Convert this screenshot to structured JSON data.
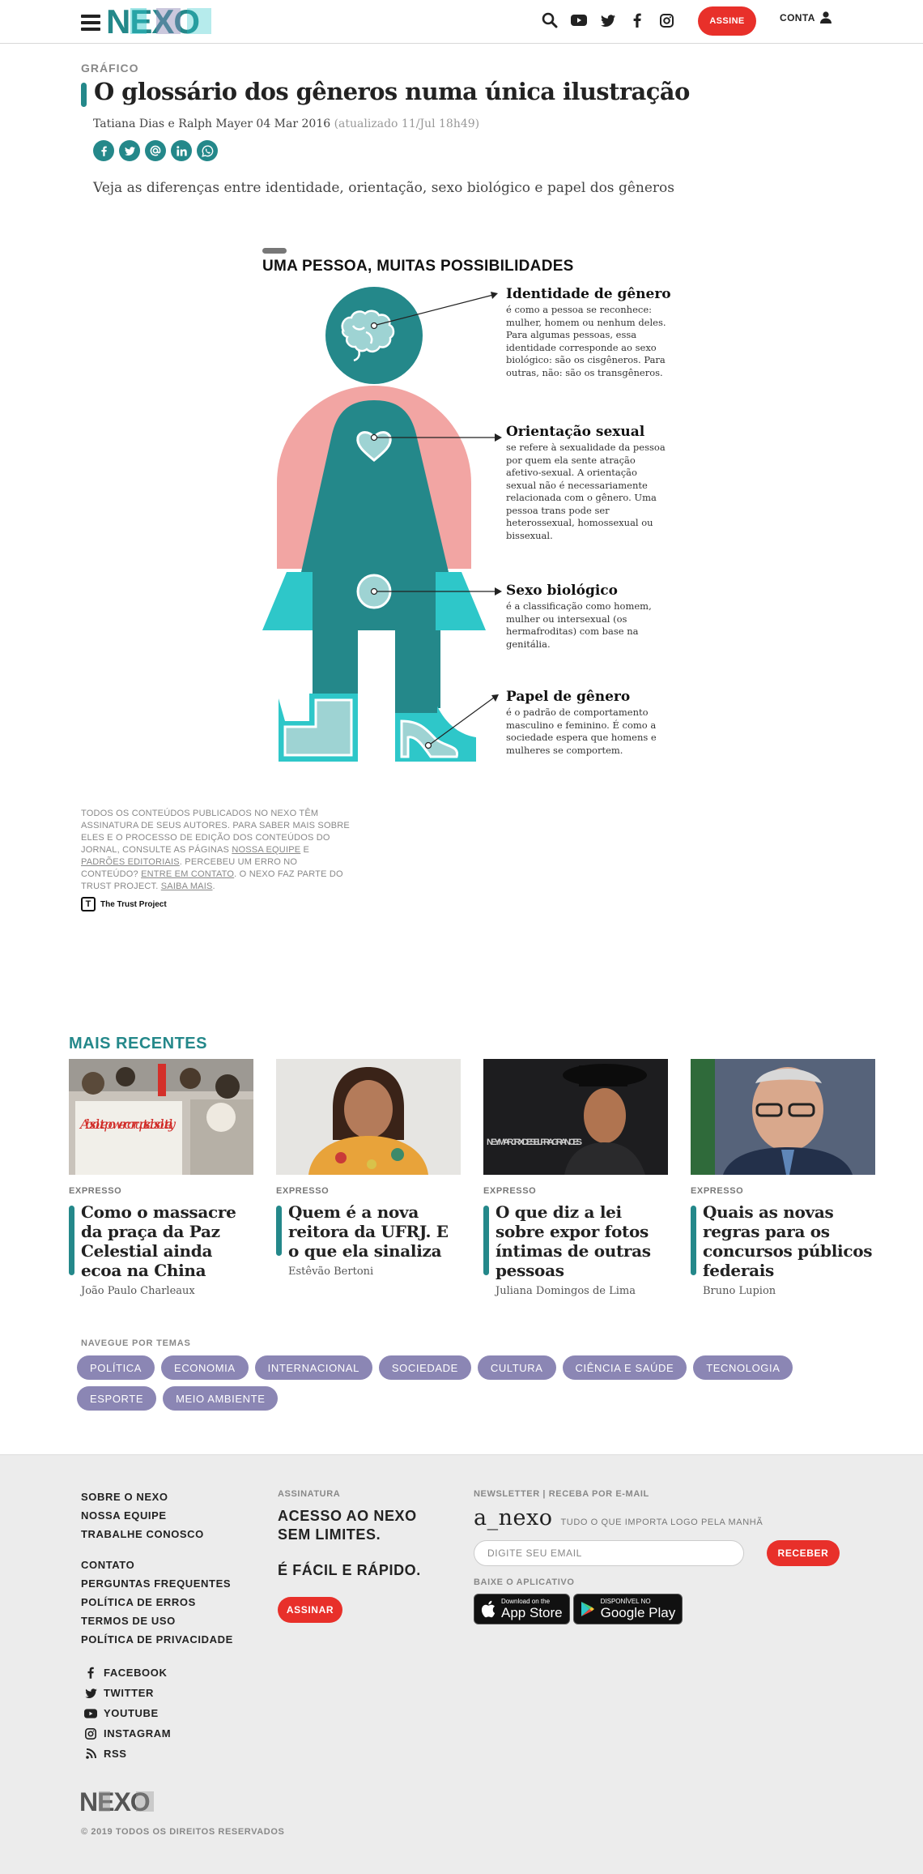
{
  "header": {
    "menu_icon": "hamburger-menu-icon",
    "logo_text": "NEXO",
    "icons": [
      "search-icon",
      "youtube-icon",
      "twitter-icon",
      "facebook-icon",
      "instagram-icon"
    ],
    "subscribe_label": "ASSINE",
    "account_label": "CONTA",
    "account_icon": "user-icon"
  },
  "article": {
    "kicker": "GRÁFICO",
    "title": "O glossário dos gêneros numa única ilustração",
    "byline": "Tatiana Dias e Ralph Mayer 04 Mar 2016",
    "updated": "(atualizado 11/Jul 18h49)",
    "share_icons": [
      "facebook-icon",
      "twitter-icon",
      "email-icon",
      "linkedin-icon",
      "whatsapp-icon"
    ],
    "summary": "Veja as diferenças entre identidade, orientação, sexo biológico e papel dos gêneros"
  },
  "infographic": {
    "heading": "UMA PESSOA, MUITAS POSSIBILIDADES",
    "items": [
      {
        "title": "Identidade de gênero",
        "text": "é como a pessoa se reconhece: mulher, homem ou nenhum deles. Para algumas pessoas, essa identidade corresponde ao sexo biológico: são os cisgêneros. Para outras, não: são os transgêneros."
      },
      {
        "title": "Orientação sexual",
        "text": "se refere à sexualidade da pessoa por quem ela sente atração afetivo-sexual. A orientação sexual não é necessariamente relacionada com o gênero. Uma pessoa trans pode ser heterossexual, homossexual ou bissexual."
      },
      {
        "title": "Sexo biológico",
        "text": "é a classificação como homem, mulher ou intersexual (os hermafroditas) com base na genitália."
      },
      {
        "title": "Papel de gênero",
        "text": "é o padrão de comportamento masculino e feminino. É como a sociedade espera que homens e mulheres se comportem."
      }
    ],
    "colors": {
      "teal": "#24888a",
      "cyan": "#2ec7c9",
      "pink": "#f2a5a3",
      "light": "#9ed3d3"
    }
  },
  "trust": {
    "text1": "Todos os conteúdos publicados no Nexo têm assinatura de seus autores. Para saber mais sobre eles e o processo de edição dos conteúdos do jornal, consulte as páginas ",
    "link1": "Nossa equipe",
    "and": " e ",
    "link2": "Padrões editoriais",
    "text2": ". Percebeu um erro no conteúdo? ",
    "link3": "Entre em contato",
    "text3": ". O Nexo faz parte do Trust Project. ",
    "link4": "Saiba mais",
    "text4": ".",
    "logo_label": "The Trust Project",
    "logo_letter": "T"
  },
  "recent": {
    "heading": "MAIS RECENTES",
    "cards": [
      {
        "tag": "EXPRESSO",
        "title": "Como o massacre da praça da Paz Celestial ainda ecoa na China",
        "author": "João Paulo Charleaux",
        "sign_text": "Absolute power corrupts absolutely"
      },
      {
        "tag": "EXPRESSO",
        "title": "Quem é a nova reitora da UFRJ. E o que ela sinaliza",
        "author": "Estêvão Bertoni"
      },
      {
        "tag": "EXPRESSO",
        "title": "O que diz a lei sobre expor fotos íntimas de outras pessoas",
        "author": "Juliana Domingos de Lima",
        "sign_text": "NEYMAR JR X DIESEL FRAGRANCES"
      },
      {
        "tag": "EXPRESSO",
        "title": "Quais as novas regras para os concursos públicos federais",
        "author": "Bruno Lupion"
      }
    ]
  },
  "themes": {
    "heading": "NAVEGUE POR TEMAS",
    "items": [
      "POLÍTICA",
      "ECONOMIA",
      "INTERNACIONAL",
      "SOCIEDADE",
      "CULTURA",
      "CIÊNCIA E SAÚDE",
      "TECNOLOGIA",
      "ESPORTE",
      "MEIO AMBIENTE"
    ]
  },
  "footer": {
    "links_a": [
      "SOBRE O NEXO",
      "NOSSA EQUIPE",
      "TRABALHE CONOSCO"
    ],
    "links_b": [
      "CONTATO",
      "PERGUNTAS FREQUENTES",
      "POLÍTICA DE ERROS",
      "TERMOS DE USO",
      "POLÍTICA DE PRIVACIDADE"
    ],
    "social": [
      {
        "label": "FACEBOOK",
        "icon": "facebook-icon"
      },
      {
        "label": "TWITTER",
        "icon": "twitter-icon"
      },
      {
        "label": "YOUTUBE",
        "icon": "youtube-icon"
      },
      {
        "label": "INSTAGRAM",
        "icon": "instagram-icon"
      },
      {
        "label": "RSS",
        "icon": "rss-icon"
      }
    ],
    "subscription_label": "ASSINATURA",
    "subscription_title": "ACESSO AO NEXO SEM LIMITES.",
    "subscription_sub": "É FÁCIL E RÁPIDO.",
    "subscribe_button": "ASSINAR",
    "newsletter_label": "NEWSLETTER | RECEBA POR E-MAIL",
    "newsletter_brand": "a_nexo",
    "newsletter_tagline": "TUDO O QUE IMPORTA LOGO PELA MANHÃ",
    "email_placeholder": "DIGITE SEU EMAIL",
    "receive_button": "RECEBER",
    "app_label": "BAIXE O APLICATIVO",
    "app_store_small": "Download on the",
    "app_store_large": "App Store",
    "google_play_small": "DISPONÍVEL NO",
    "google_play_large": "Google Play",
    "logo_text": "NEXO",
    "copyright": "© 2019 TODOS OS DIREITOS RESERVADOS"
  }
}
